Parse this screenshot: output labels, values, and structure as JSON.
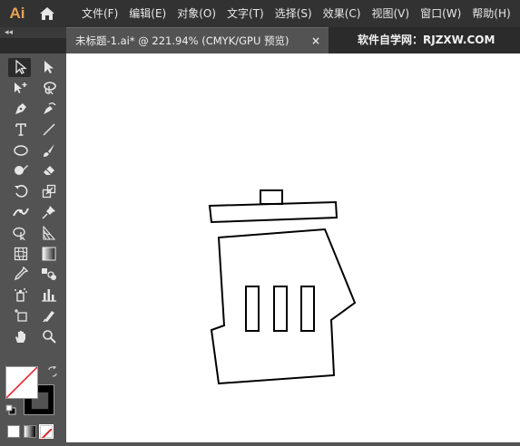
{
  "app": {
    "logo": "Ai"
  },
  "menu": [
    "文件(F)",
    "编辑(E)",
    "对象(O)",
    "文字(T)",
    "选择(S)",
    "效果(C)",
    "视图(V)",
    "窗口(W)",
    "帮助(H)"
  ],
  "tabbar": {
    "collapse_glyph": "◂◂",
    "tab_title": "未标题-1.ai* @ 221.94% (CMYK/GPU 预览)",
    "close_glyph": "×",
    "watermark": "软件自学网：RJZXW.COM"
  },
  "tools": [
    {
      "name": "selection-tool",
      "icon": "selection-arrow-icon",
      "selected": true
    },
    {
      "name": "direct-selection-tool",
      "icon": "direct-selection-arrow-icon"
    },
    {
      "name": "magic-wand-tool",
      "icon": "magic-wand-icon"
    },
    {
      "name": "lasso-tool",
      "icon": "lasso-icon"
    },
    {
      "name": "pen-tool",
      "icon": "pen-icon"
    },
    {
      "name": "curvature-tool",
      "icon": "curvature-pen-icon"
    },
    {
      "name": "type-tool",
      "icon": "type-icon"
    },
    {
      "name": "line-tool",
      "icon": "line-segment-icon"
    },
    {
      "name": "ellipse-tool",
      "icon": "ellipse-icon"
    },
    {
      "name": "paintbrush-tool",
      "icon": "paintbrush-icon"
    },
    {
      "name": "shaper-tool",
      "icon": "shaper-icon"
    },
    {
      "name": "eraser-tool",
      "icon": "eraser-icon"
    },
    {
      "name": "rotate-tool",
      "icon": "rotate-icon"
    },
    {
      "name": "scale-tool",
      "icon": "scale-icon"
    },
    {
      "name": "width-tool",
      "icon": "width-icon"
    },
    {
      "name": "puppet-warp-tool",
      "icon": "pushpin-icon"
    },
    {
      "name": "shape-builder-tool",
      "icon": "shape-builder-icon"
    },
    {
      "name": "perspective-grid-tool",
      "icon": "perspective-grid-icon"
    },
    {
      "name": "mesh-tool",
      "icon": "mesh-icon"
    },
    {
      "name": "gradient-tool",
      "icon": "gradient-icon"
    },
    {
      "name": "eyedropper-tool",
      "icon": "eyedropper-icon"
    },
    {
      "name": "blend-tool",
      "icon": "blend-icon"
    },
    {
      "name": "symbol-sprayer-tool",
      "icon": "symbol-sprayer-icon"
    },
    {
      "name": "column-graph-tool",
      "icon": "column-graph-icon"
    },
    {
      "name": "artboard-tool",
      "icon": "artboard-icon"
    },
    {
      "name": "slice-tool",
      "icon": "slice-icon"
    },
    {
      "name": "hand-tool",
      "icon": "hand-icon"
    },
    {
      "name": "zoom-tool",
      "icon": "zoom-icon"
    }
  ],
  "colors": {
    "menubar_bg": "#323232",
    "panel_bg": "#535353",
    "canvas_bg": "#ffffff",
    "fill": "#ffffff",
    "stroke": "#000000",
    "logo": "#e8a15a",
    "none_slash": "#e0262c"
  }
}
